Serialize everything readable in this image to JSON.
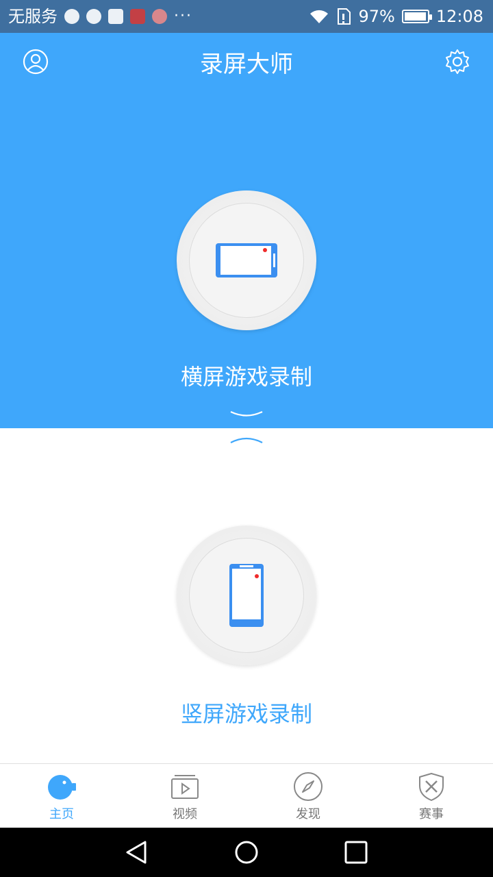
{
  "status_bar": {
    "carrier": "无服务",
    "more": "···",
    "battery_percent": "97%",
    "battery_level": 0.97,
    "time": "12:08",
    "icons": [
      "app-notification-icon",
      "sync-icon",
      "heart-rate-icon",
      "calendar-icon",
      "blocked-icon",
      "wifi-icon",
      "sim-card-icon",
      "battery-icon"
    ]
  },
  "header": {
    "title": "录屏大师",
    "left_icon": "user-icon",
    "right_icon": "gear-icon"
  },
  "modes": {
    "landscape": {
      "label": "横屏游戏录制",
      "icon": "landscape-phone-icon"
    },
    "portrait": {
      "label": "竖屏游戏录制",
      "icon": "portrait-phone-icon"
    }
  },
  "tabs": [
    {
      "label": "主页",
      "icon": "camera-icon",
      "active": true
    },
    {
      "label": "视频",
      "icon": "video-icon",
      "active": false
    },
    {
      "label": "发现",
      "icon": "compass-icon",
      "active": false
    },
    {
      "label": "赛事",
      "icon": "shield-swords-icon",
      "active": false
    }
  ],
  "colors": {
    "accent": "#3fa7fb",
    "status_bar": "#3f6f9f",
    "record_dot": "#ef2b2b",
    "inactive_tab": "#777777"
  }
}
